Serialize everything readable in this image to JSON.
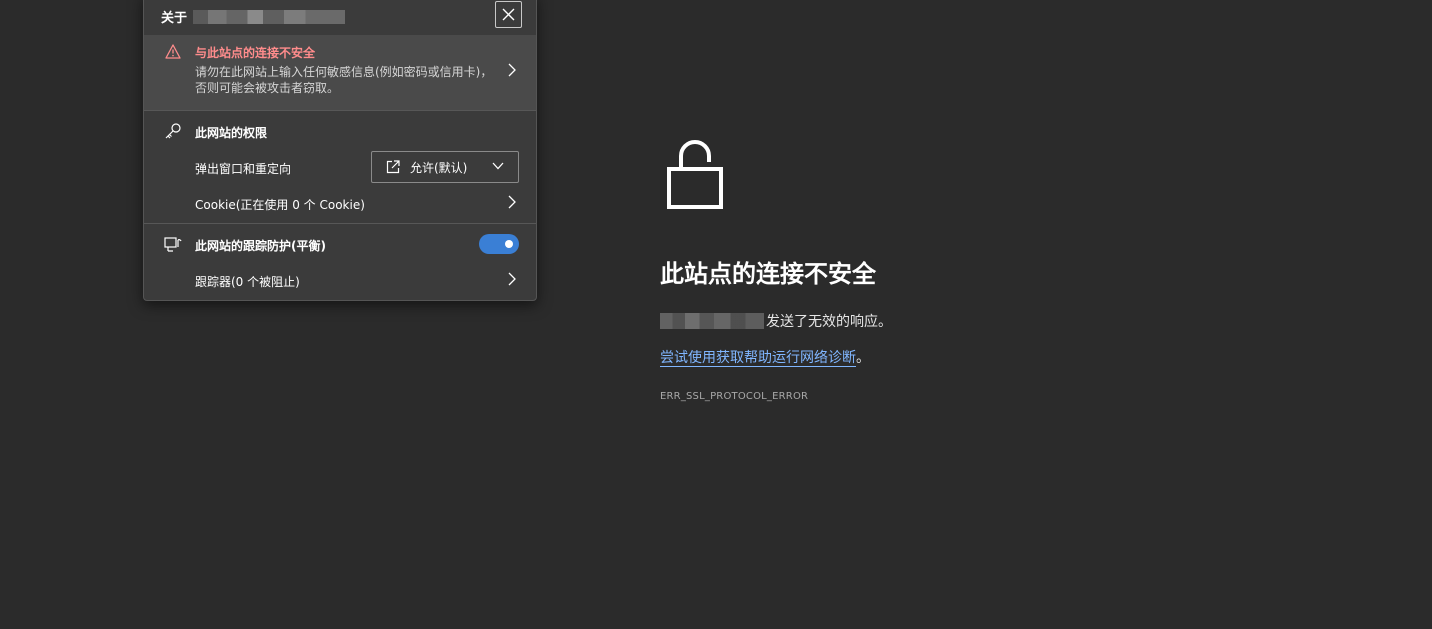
{
  "error_page": {
    "title": "此站点的连接不安全",
    "detail_suffix": "发送了无效的响应。",
    "help_link": "尝试使用获取帮助运行网络诊断",
    "help_suffix": "。",
    "error_code": "ERR_SSL_PROTOCOL_ERROR",
    "icon": "unlocked-padlock-icon"
  },
  "site_info": {
    "title_prefix": "关于",
    "warning": {
      "title": "与此站点的连接不安全",
      "description": "请勿在此网站上输入任何敏感信息(例如密码或信用卡)，否则可能会被攻击者窃取。",
      "icon": "warning-triangle-icon"
    },
    "permissions": {
      "heading": "此网站的权限",
      "icon": "key-icon",
      "popups_label": "弹出窗口和重定向",
      "popups_value": "允许(默认)",
      "cookies_label": "Cookie(正在使用 0 个 Cookie)"
    },
    "tracking": {
      "heading": "此网站的跟踪防护(平衡)",
      "icon": "tracking-prevention-icon",
      "enabled": true,
      "trackers_label": "跟踪器(0 个被阻止)"
    }
  },
  "colors": {
    "background": "#2b2b2b",
    "flyout": "#3b3b3b",
    "warning_text": "#ff8c8c",
    "link": "#80b6ff",
    "toggle_on": "#3a7fd5"
  }
}
